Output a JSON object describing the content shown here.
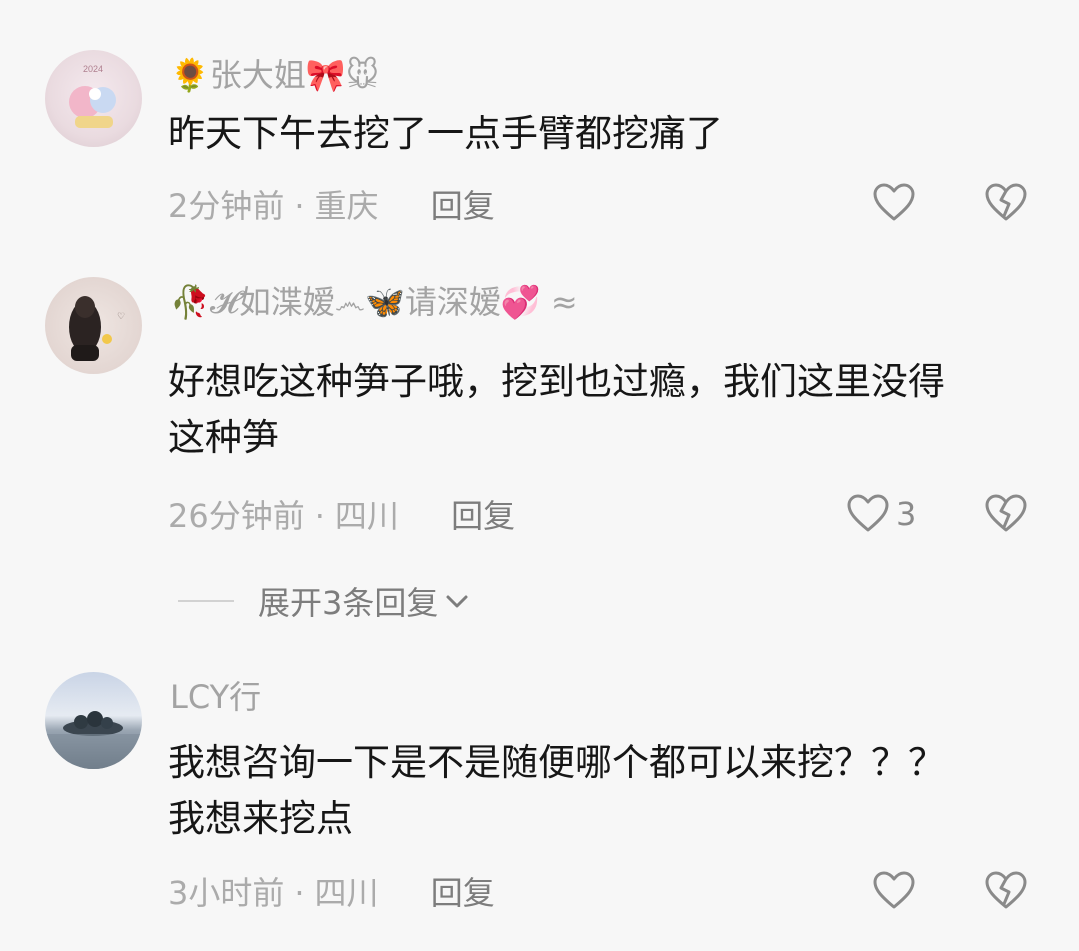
{
  "comments": [
    {
      "username": "🌻张大姐🎀🐭",
      "text_lines": [
        "昨天下午去挖了一点手臂都挖痛了"
      ],
      "time": "2分钟前",
      "location": "重庆",
      "reply_label": "回复",
      "like_count": "",
      "avatar_text": "2024",
      "icons": {
        "like": "heart-outline-icon",
        "dislike": "broken-heart-icon"
      }
    },
    {
      "username": "🥀𝓗如渫嫒෴🦋请深嫒💞 ≈",
      "text_lines": [
        "好想吃这种笋子哦，挖到也过瘾，我们这里没得",
        "这种笋"
      ],
      "time": "26分钟前",
      "location": "四川",
      "reply_label": "回复",
      "like_count": "3",
      "avatar_text": "",
      "icons": {
        "like": "heart-outline-icon",
        "dislike": "broken-heart-icon"
      }
    },
    {
      "username": "LCY行",
      "text_lines": [
        "我想咨询一下是不是随便哪个都可以来挖？？？",
        "我想来挖点"
      ],
      "time": "3小时前",
      "location": "四川",
      "reply_label": "回复",
      "like_count": "",
      "avatar_text": "",
      "icons": {
        "like": "heart-outline-icon",
        "dislike": "broken-heart-icon"
      }
    }
  ],
  "expand_replies": {
    "label": "展开3条回复",
    "icon": "chevron-down-icon"
  },
  "colors": {
    "background": "#f7f7f7",
    "username": "#a3a3a3",
    "text": "#161616",
    "meta": "#ababab"
  }
}
